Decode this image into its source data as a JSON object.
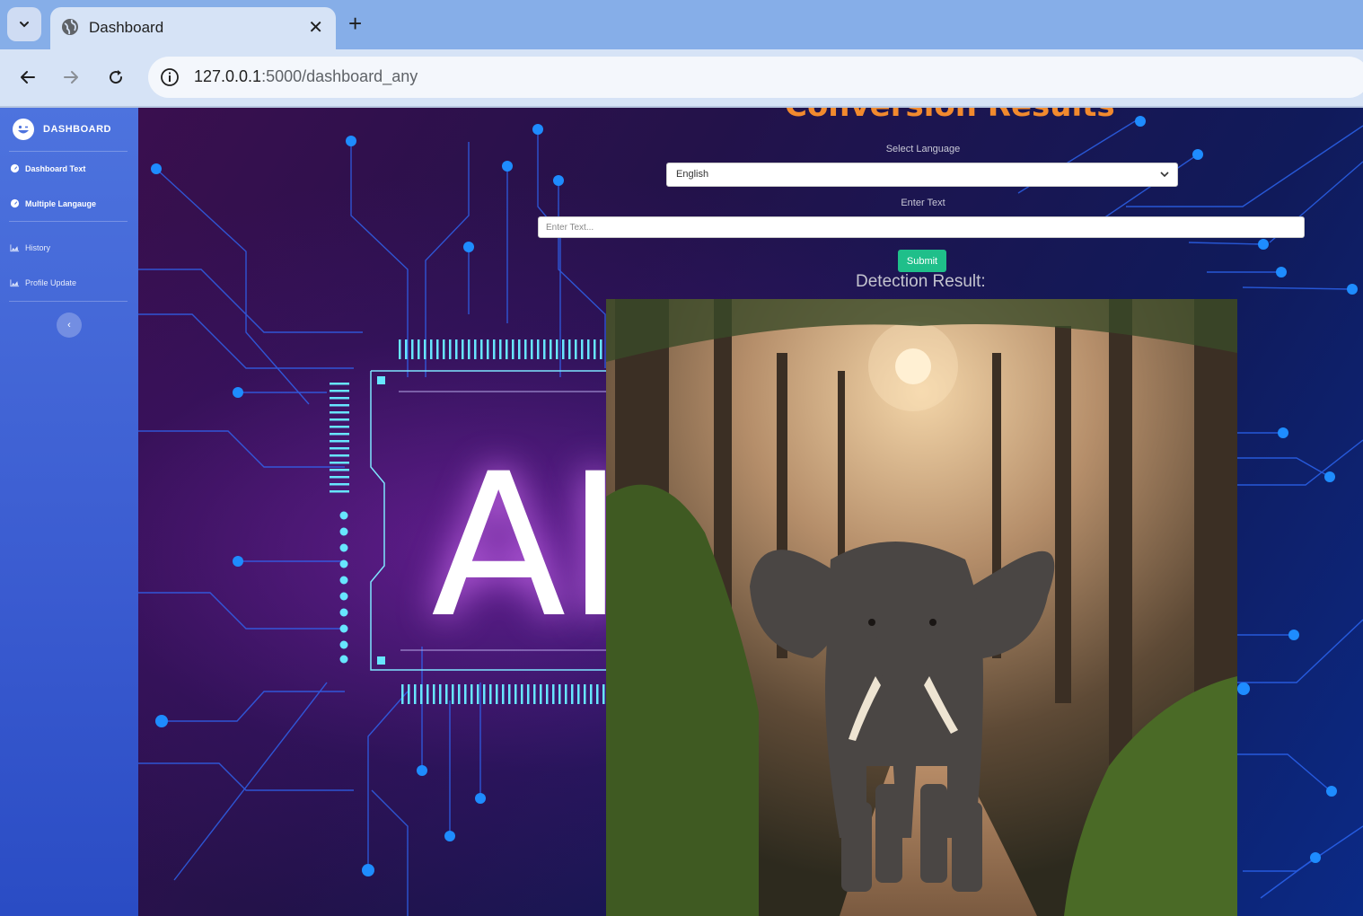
{
  "browser": {
    "tab_title": "Dashboard",
    "tab_close": "✕",
    "new_tab": "+",
    "url_host": "127.0.0.1",
    "url_path": ":5000/dashboard_any"
  },
  "sidebar": {
    "brand": "DASHBOARD",
    "items": [
      {
        "label": "Dashboard Text"
      },
      {
        "label": "Multiple Langauge"
      },
      {
        "label": "History"
      },
      {
        "label": "Profile Update"
      }
    ],
    "collapse_glyph": "‹"
  },
  "main": {
    "hero_letter": "AI",
    "title": "Conversion Results",
    "select_label": "Select Language",
    "select_value": "English",
    "text_label": "Enter Text",
    "text_placeholder": "Enter Text...",
    "submit_label": "Submit",
    "detection_title": "Detection Result:"
  },
  "colors": {
    "accent_orange": "#f28a2e",
    "submit_green": "#1fbf8a",
    "sidebar_blue": "#4d73de"
  }
}
